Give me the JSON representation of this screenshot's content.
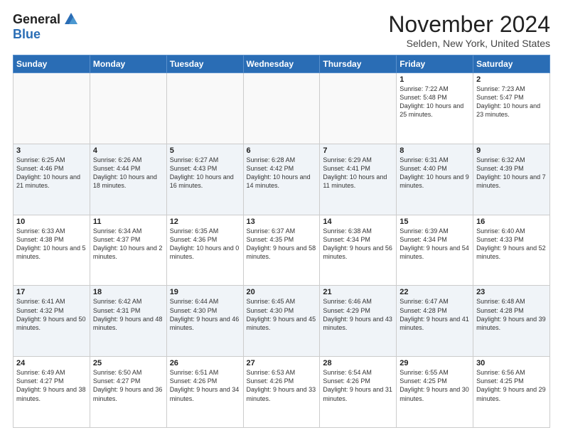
{
  "logo": {
    "general": "General",
    "blue": "Blue"
  },
  "header": {
    "month": "November 2024",
    "location": "Selden, New York, United States"
  },
  "weekdays": [
    "Sunday",
    "Monday",
    "Tuesday",
    "Wednesday",
    "Thursday",
    "Friday",
    "Saturday"
  ],
  "weeks": [
    [
      {
        "day": "",
        "info": ""
      },
      {
        "day": "",
        "info": ""
      },
      {
        "day": "",
        "info": ""
      },
      {
        "day": "",
        "info": ""
      },
      {
        "day": "",
        "info": ""
      },
      {
        "day": "1",
        "info": "Sunrise: 7:22 AM\nSunset: 5:48 PM\nDaylight: 10 hours and 25 minutes."
      },
      {
        "day": "2",
        "info": "Sunrise: 7:23 AM\nSunset: 5:47 PM\nDaylight: 10 hours and 23 minutes."
      }
    ],
    [
      {
        "day": "3",
        "info": "Sunrise: 6:25 AM\nSunset: 4:46 PM\nDaylight: 10 hours and 21 minutes."
      },
      {
        "day": "4",
        "info": "Sunrise: 6:26 AM\nSunset: 4:44 PM\nDaylight: 10 hours and 18 minutes."
      },
      {
        "day": "5",
        "info": "Sunrise: 6:27 AM\nSunset: 4:43 PM\nDaylight: 10 hours and 16 minutes."
      },
      {
        "day": "6",
        "info": "Sunrise: 6:28 AM\nSunset: 4:42 PM\nDaylight: 10 hours and 14 minutes."
      },
      {
        "day": "7",
        "info": "Sunrise: 6:29 AM\nSunset: 4:41 PM\nDaylight: 10 hours and 11 minutes."
      },
      {
        "day": "8",
        "info": "Sunrise: 6:31 AM\nSunset: 4:40 PM\nDaylight: 10 hours and 9 minutes."
      },
      {
        "day": "9",
        "info": "Sunrise: 6:32 AM\nSunset: 4:39 PM\nDaylight: 10 hours and 7 minutes."
      }
    ],
    [
      {
        "day": "10",
        "info": "Sunrise: 6:33 AM\nSunset: 4:38 PM\nDaylight: 10 hours and 5 minutes."
      },
      {
        "day": "11",
        "info": "Sunrise: 6:34 AM\nSunset: 4:37 PM\nDaylight: 10 hours and 2 minutes."
      },
      {
        "day": "12",
        "info": "Sunrise: 6:35 AM\nSunset: 4:36 PM\nDaylight: 10 hours and 0 minutes."
      },
      {
        "day": "13",
        "info": "Sunrise: 6:37 AM\nSunset: 4:35 PM\nDaylight: 9 hours and 58 minutes."
      },
      {
        "day": "14",
        "info": "Sunrise: 6:38 AM\nSunset: 4:34 PM\nDaylight: 9 hours and 56 minutes."
      },
      {
        "day": "15",
        "info": "Sunrise: 6:39 AM\nSunset: 4:34 PM\nDaylight: 9 hours and 54 minutes."
      },
      {
        "day": "16",
        "info": "Sunrise: 6:40 AM\nSunset: 4:33 PM\nDaylight: 9 hours and 52 minutes."
      }
    ],
    [
      {
        "day": "17",
        "info": "Sunrise: 6:41 AM\nSunset: 4:32 PM\nDaylight: 9 hours and 50 minutes."
      },
      {
        "day": "18",
        "info": "Sunrise: 6:42 AM\nSunset: 4:31 PM\nDaylight: 9 hours and 48 minutes."
      },
      {
        "day": "19",
        "info": "Sunrise: 6:44 AM\nSunset: 4:30 PM\nDaylight: 9 hours and 46 minutes."
      },
      {
        "day": "20",
        "info": "Sunrise: 6:45 AM\nSunset: 4:30 PM\nDaylight: 9 hours and 45 minutes."
      },
      {
        "day": "21",
        "info": "Sunrise: 6:46 AM\nSunset: 4:29 PM\nDaylight: 9 hours and 43 minutes."
      },
      {
        "day": "22",
        "info": "Sunrise: 6:47 AM\nSunset: 4:28 PM\nDaylight: 9 hours and 41 minutes."
      },
      {
        "day": "23",
        "info": "Sunrise: 6:48 AM\nSunset: 4:28 PM\nDaylight: 9 hours and 39 minutes."
      }
    ],
    [
      {
        "day": "24",
        "info": "Sunrise: 6:49 AM\nSunset: 4:27 PM\nDaylight: 9 hours and 38 minutes."
      },
      {
        "day": "25",
        "info": "Sunrise: 6:50 AM\nSunset: 4:27 PM\nDaylight: 9 hours and 36 minutes."
      },
      {
        "day": "26",
        "info": "Sunrise: 6:51 AM\nSunset: 4:26 PM\nDaylight: 9 hours and 34 minutes."
      },
      {
        "day": "27",
        "info": "Sunrise: 6:53 AM\nSunset: 4:26 PM\nDaylight: 9 hours and 33 minutes."
      },
      {
        "day": "28",
        "info": "Sunrise: 6:54 AM\nSunset: 4:26 PM\nDaylight: 9 hours and 31 minutes."
      },
      {
        "day": "29",
        "info": "Sunrise: 6:55 AM\nSunset: 4:25 PM\nDaylight: 9 hours and 30 minutes."
      },
      {
        "day": "30",
        "info": "Sunrise: 6:56 AM\nSunset: 4:25 PM\nDaylight: 9 hours and 29 minutes."
      }
    ]
  ]
}
